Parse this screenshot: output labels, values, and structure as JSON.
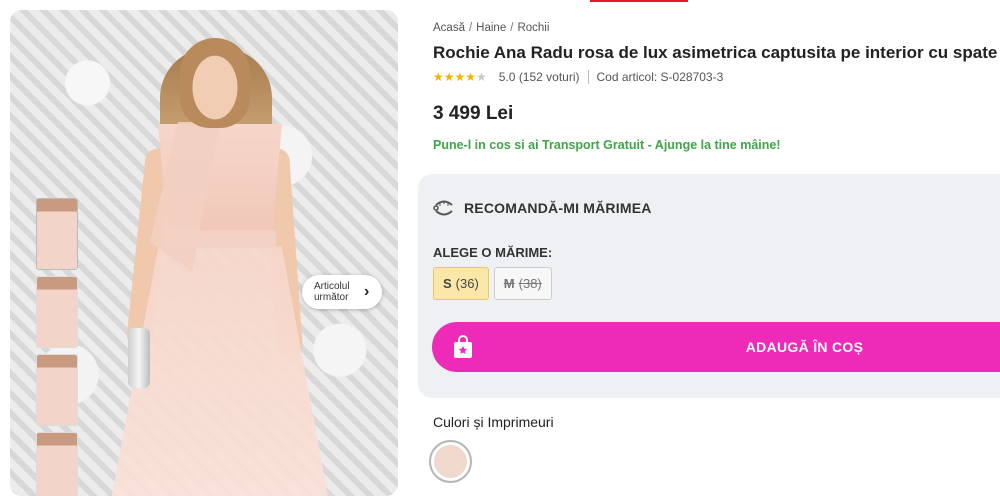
{
  "breadcrumb": {
    "home": "Acasă",
    "category": "Haine",
    "subcategory": "Rochii",
    "separator": "/"
  },
  "product": {
    "title": "Rochie Ana Radu rosa de lux asimetrica captusita pe interior cu spate gol",
    "rating": {
      "stars_filled": 4,
      "stars_total": 5,
      "text": "5.0 (152 voturi)"
    },
    "code": "Cod articol: S-028703-3",
    "price": "3 499 Lei",
    "shipping_note": "Pune-l in cos si ai Transport Gratuit - Ajunge la tine mâine!"
  },
  "gallery": {
    "next_article_label": "Articolul următor",
    "thumbnail_count": 4,
    "active_thumbnail": 1
  },
  "size_section": {
    "recommend_label": "RECOMANDĂ-MI MĂRIMEA",
    "choose_label": "ALEGE O MĂRIME:",
    "sizes": [
      {
        "size": "S",
        "detail": "(36)",
        "state": "selected"
      },
      {
        "size": "M",
        "detail": "(38)",
        "state": "unavailable"
      }
    ]
  },
  "cart": {
    "add_label": "ADAUGĂ ÎN COȘ"
  },
  "colors": {
    "title": "Culori și Imprimeuri",
    "swatches": [
      {
        "color": "#f0d8cd",
        "selected": true
      }
    ]
  },
  "theme": {
    "accent_pink": "#ee2ab8",
    "success_green": "#3fa647",
    "star_yellow": "#f5b301",
    "selected_size_bg": "#fbe7a8"
  }
}
